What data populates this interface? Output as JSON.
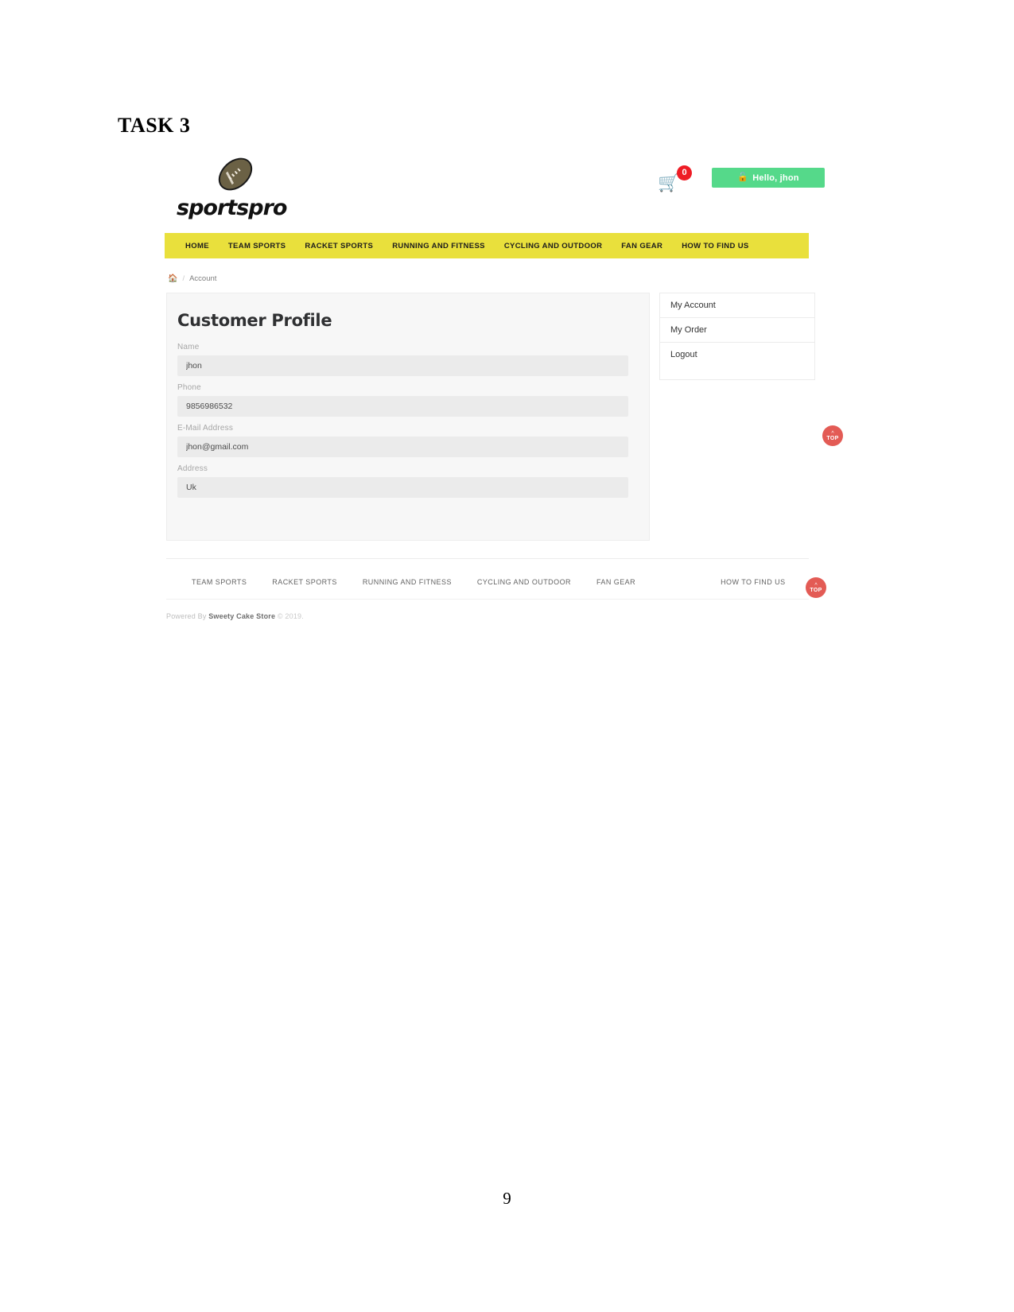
{
  "document": {
    "task_title": "TASK 3",
    "page_number": "9"
  },
  "header": {
    "brand_name": "sportspro",
    "brand_icon": "football-icon",
    "cart_icon": "shopping-cart-icon",
    "cart_count": "0",
    "greeting_icon": "unlock-icon",
    "greeting_label": "Hello, jhon"
  },
  "main_nav": {
    "items": [
      {
        "label": "HOME"
      },
      {
        "label": "TEAM SPORTS"
      },
      {
        "label": "RACKET SPORTS"
      },
      {
        "label": "RUNNING AND FITNESS"
      },
      {
        "label": "CYCLING AND OUTDOOR"
      },
      {
        "label": "FAN GEAR"
      },
      {
        "label": "HOW TO FIND US"
      }
    ]
  },
  "breadcrumb": {
    "home_icon": "home-icon",
    "separator": "/",
    "current": "Account"
  },
  "profile": {
    "title": "Customer Profile",
    "fields": [
      {
        "label": "Name",
        "value": "jhon",
        "placeholder": "Name"
      },
      {
        "label": "Phone",
        "value": "9856986532",
        "placeholder": "Phone"
      },
      {
        "label": "E-Mail Address",
        "value": "jhon@gmail.com",
        "placeholder": "E-Mail Address"
      },
      {
        "label": "Address",
        "value": "Uk",
        "placeholder": "Address"
      }
    ]
  },
  "account_menu": {
    "items": [
      {
        "label": "My Account"
      },
      {
        "label": "My Order"
      },
      {
        "label": "Logout"
      }
    ]
  },
  "scroll_top": {
    "caret": "^",
    "label": "TOP"
  },
  "footer_nav": {
    "items": [
      {
        "label": "TEAM SPORTS"
      },
      {
        "label": "RACKET SPORTS"
      },
      {
        "label": "RUNNING AND FITNESS"
      },
      {
        "label": "CYCLING AND OUTDOOR"
      },
      {
        "label": "FAN GEAR"
      },
      {
        "label": "HOW TO FIND US"
      }
    ]
  },
  "footer": {
    "powered_by": "Powered By",
    "store_name": "Sweety Cake Store",
    "copyright": "© 2019."
  },
  "colors": {
    "nav_yellow": "#e9e03c",
    "greeting_green": "#55d98a",
    "badge_red": "#ee1c25",
    "top_button_red": "#e35b55"
  }
}
